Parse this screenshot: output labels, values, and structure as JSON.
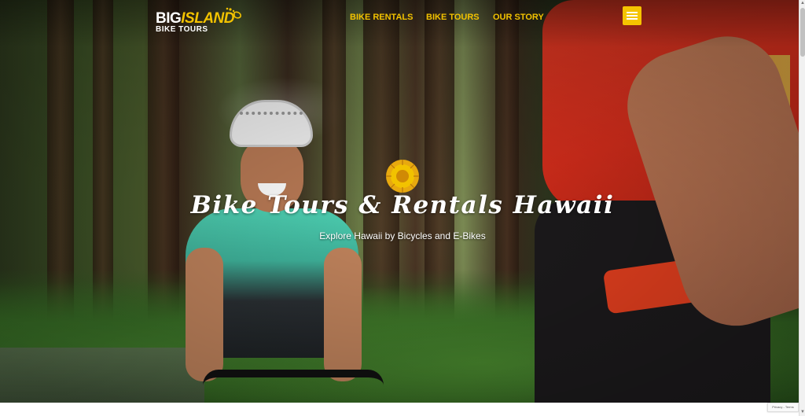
{
  "logo": {
    "line1_white": "BIG",
    "line1_yellow": "ISLAND",
    "line2": "BIKE TOURS"
  },
  "nav": {
    "items": [
      "BIKE RENTALS",
      "BIKE TOURS",
      "OUR STORY"
    ]
  },
  "hero": {
    "title": "Bike Tours & Rentals Hawaii",
    "subtitle": "Explore Hawaii by Bicycles and E-Bikes"
  },
  "recaptcha": {
    "label": "Privacy - Terms"
  },
  "colors": {
    "accent": "#f2c200",
    "menu_button": "#f5c400",
    "text_light": "#ffffff"
  },
  "icons": {
    "menu": "hamburger-menu-icon",
    "hero_emblem": "sun-emblem-icon",
    "logo_islands": "hawaii-islands-icon"
  }
}
